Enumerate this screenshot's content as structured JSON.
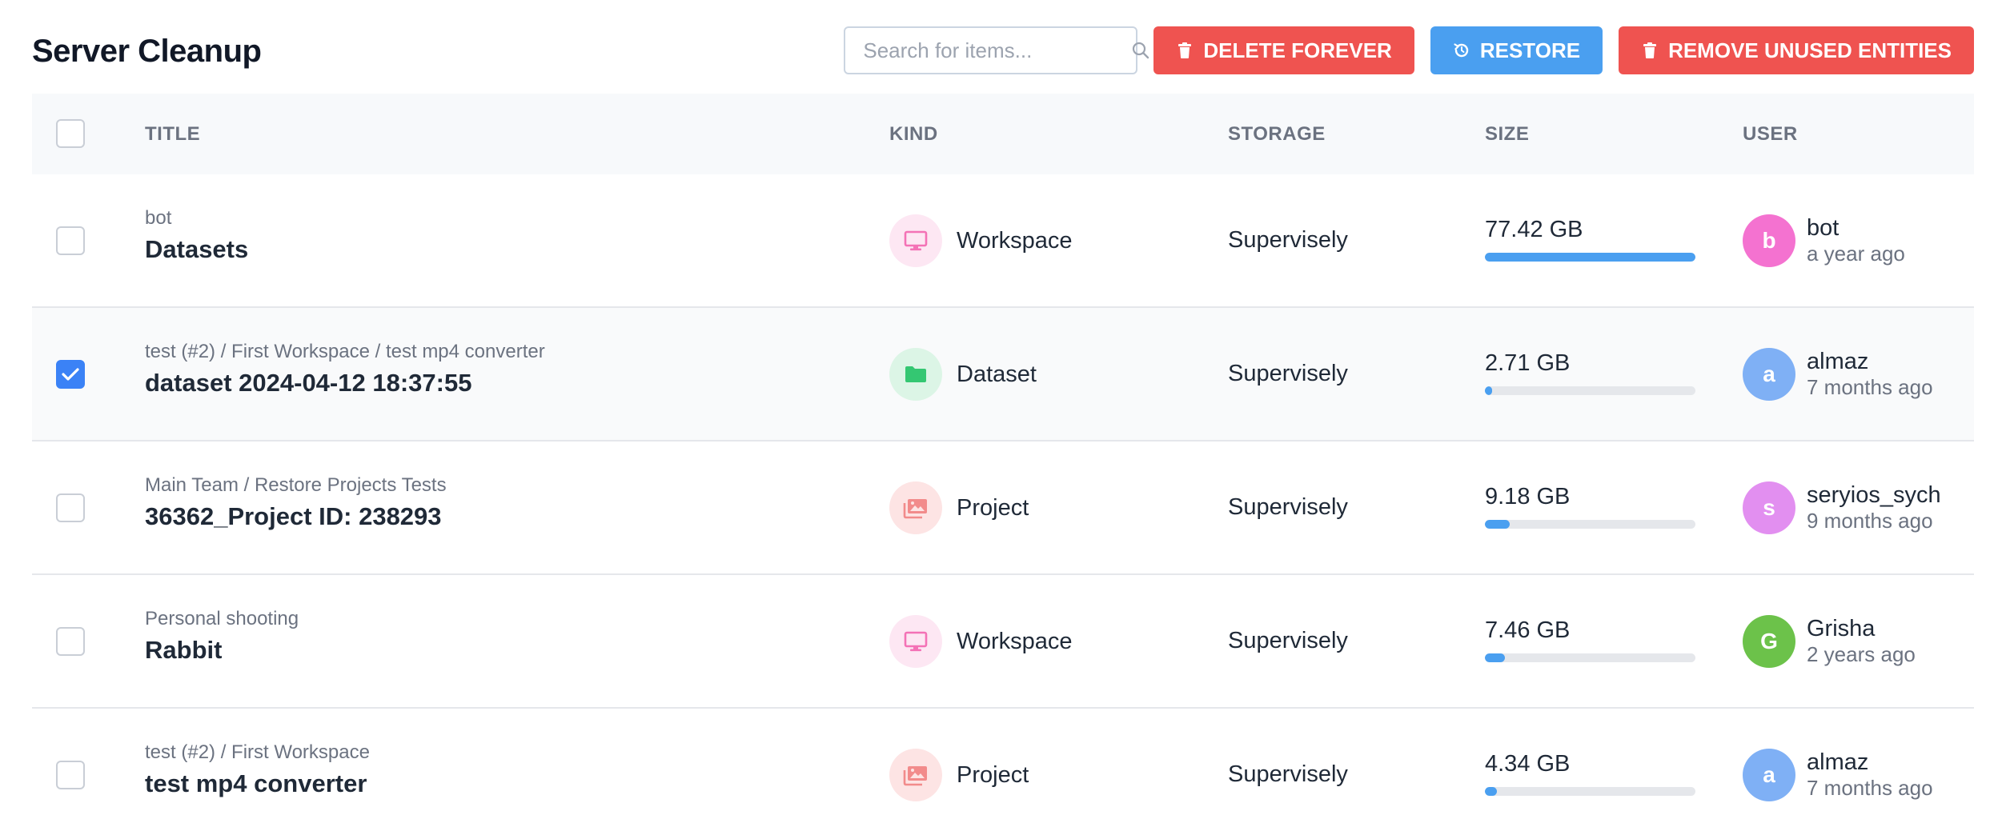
{
  "page": {
    "title": "Server Cleanup"
  },
  "toolbar": {
    "search_placeholder": "Search for items...",
    "search_icon": "search-icon",
    "delete_label": "DELETE FOREVER",
    "restore_label": "RESTORE",
    "remove_unused_label": "REMOVE UNUSED ENTITIES",
    "colors": {
      "danger": "#ef5350",
      "primary": "#4a9ff0"
    }
  },
  "table": {
    "headers": {
      "title": "TITLE",
      "kind": "KIND",
      "storage": "STORAGE",
      "size": "SIZE",
      "user": "USER"
    },
    "rows": [
      {
        "checked": false,
        "path": "bot",
        "name": "Datasets",
        "kind": "Workspace",
        "kind_icon": "monitor-icon",
        "storage": "Supervisely",
        "size": "77.42 GB",
        "size_fraction": 1.0,
        "user": "bot",
        "user_initial": "b",
        "avatar_color": "#f472d0",
        "time": "a year ago"
      },
      {
        "checked": true,
        "path": "test (#2) / First Workspace / test mp4 converter",
        "name": "dataset 2024-04-12 18:37:55",
        "kind": "Dataset",
        "kind_icon": "folder-icon",
        "storage": "Supervisely",
        "size": "2.71 GB",
        "size_fraction": 0.035,
        "user": "almaz",
        "user_initial": "a",
        "avatar_color": "#7fb0f5",
        "time": "7 months ago"
      },
      {
        "checked": false,
        "path": "Main Team / Restore Projects Tests",
        "name": "36362_Project ID: 238293",
        "kind": "Project",
        "kind_icon": "images-icon",
        "storage": "Supervisely",
        "size": "9.18 GB",
        "size_fraction": 0.118,
        "user": "seryios_sych",
        "user_initial": "s",
        "avatar_color": "#e28ff0",
        "time": "9 months ago"
      },
      {
        "checked": false,
        "path": "Personal shooting",
        "name": "Rabbit",
        "kind": "Workspace",
        "kind_icon": "monitor-icon",
        "storage": "Supervisely",
        "size": "7.46 GB",
        "size_fraction": 0.096,
        "user": "Grisha",
        "user_initial": "G",
        "avatar_color": "#6cc24a",
        "time": "2 years ago"
      },
      {
        "checked": false,
        "path": "test (#2) / First Workspace",
        "name": "test mp4 converter",
        "kind": "Project",
        "kind_icon": "images-icon",
        "storage": "Supervisely",
        "size": "4.34 GB",
        "size_fraction": 0.056,
        "user": "almaz",
        "user_initial": "a",
        "avatar_color": "#7fb0f5",
        "time": "7 months ago"
      }
    ]
  }
}
